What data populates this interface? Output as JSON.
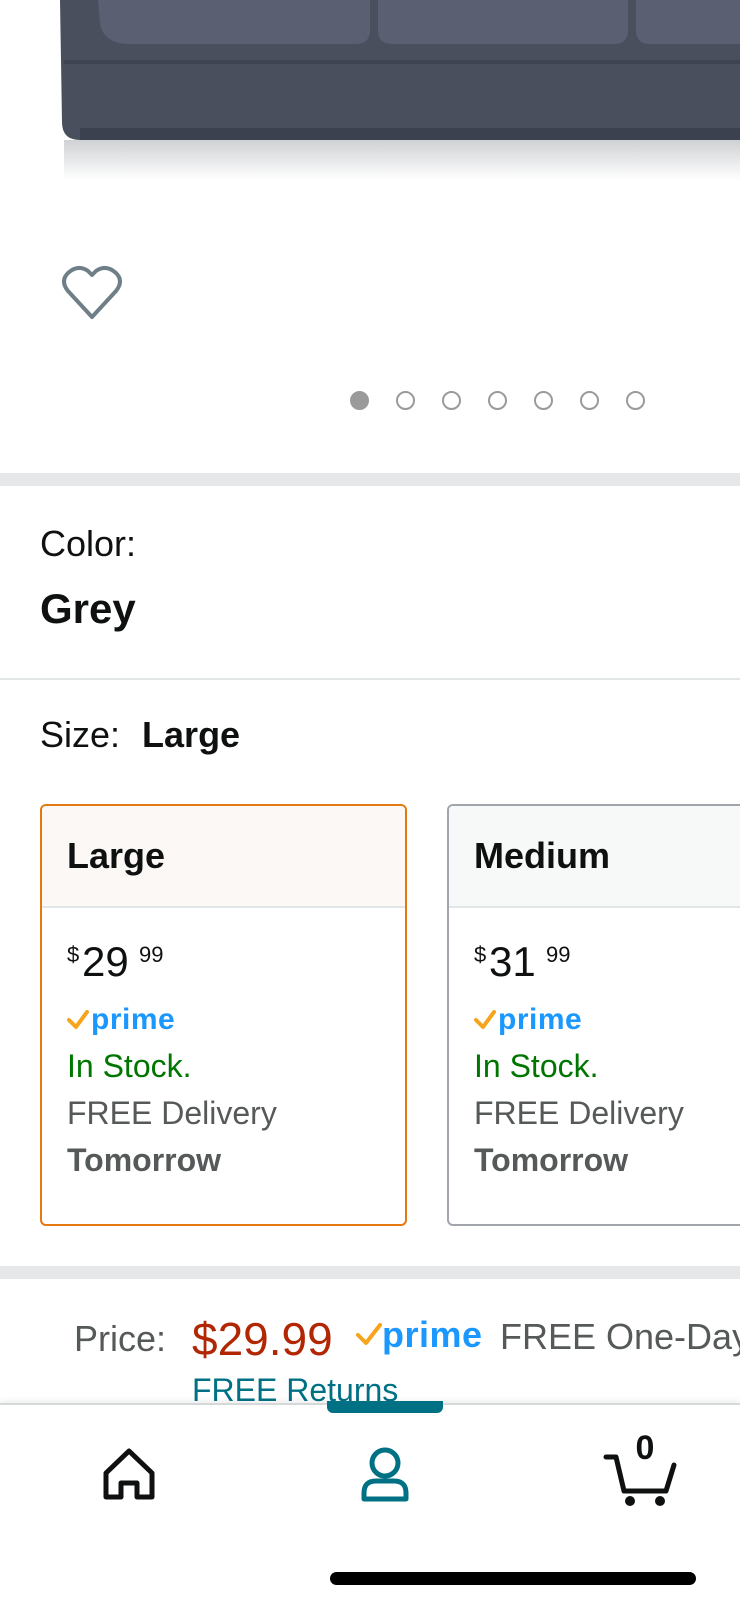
{
  "product": {
    "image_alt": "Grey sofa",
    "carousel": {
      "count": 7,
      "active_index": 0
    }
  },
  "color": {
    "label": "Color:",
    "value": "Grey"
  },
  "size": {
    "label": "Size:",
    "value": "Large",
    "options": [
      {
        "name": "Large",
        "currency": "$",
        "whole": "29",
        "fraction": "99",
        "prime": "prime",
        "stock": "In Stock.",
        "delivery": "FREE Delivery",
        "when": "Tomorrow",
        "selected": true
      },
      {
        "name": "Medium",
        "currency": "$",
        "whole": "31",
        "fraction": "99",
        "prime": "prime",
        "stock": "In Stock.",
        "delivery": "FREE Delivery",
        "when": "Tomorrow",
        "selected": false
      }
    ]
  },
  "price_bar": {
    "label": "Price:",
    "price": "$29.99",
    "prime": "prime",
    "shipping": "FREE One-Day",
    "returns": "FREE Returns"
  },
  "tabbar": {
    "tabs": [
      {
        "name": "home",
        "icon": "home-icon"
      },
      {
        "name": "account",
        "icon": "user-icon",
        "active": true
      },
      {
        "name": "cart",
        "icon": "cart-icon",
        "count": "0"
      }
    ]
  },
  "colors": {
    "accent": "#007185",
    "selected_border": "#e47911",
    "price_red": "#b12704",
    "stock_green": "#007600",
    "prime_blue": "#1a98ff"
  }
}
